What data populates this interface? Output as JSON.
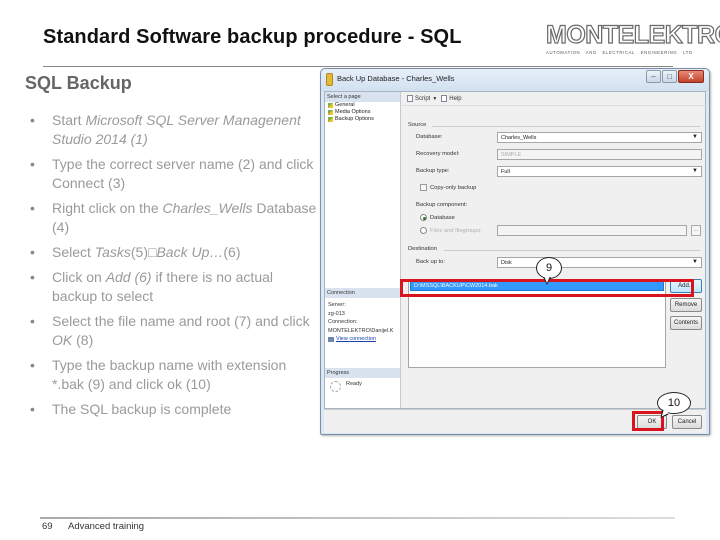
{
  "slide": {
    "title": "Standard Software backup procedure - SQL",
    "logo": {
      "name": "MONTELEKTRO",
      "tagline": "AUTOMATION AND ELECTRICAL ENGINEERING LTD"
    },
    "section_heading": "SQL Backup",
    "bullet_glyph": "•",
    "bullets": [
      {
        "parts": [
          {
            "text": "Start ",
            "italic": false
          },
          {
            "text": "Microsoft SQL Server Managenent Studio 2014 (1)",
            "italic": true
          }
        ]
      },
      {
        "parts": [
          {
            "text": "Type the correct server name (2) and click Connect (3)",
            "italic": false
          }
        ]
      },
      {
        "parts": [
          {
            "text": "Right click on the ",
            "italic": false
          },
          {
            "text": "Charles_Wells",
            "italic": true
          },
          {
            "text": " Database (4)",
            "italic": false
          }
        ]
      },
      {
        "parts": [
          {
            "text": "Select ",
            "italic": false
          },
          {
            "text": "Tasks",
            "italic": true
          },
          {
            "text": "(5)□",
            "italic": false
          },
          {
            "text": "Back Up…",
            "italic": true
          },
          {
            "text": "(6)",
            "italic": false
          }
        ]
      },
      {
        "parts": [
          {
            "text": "Click on ",
            "italic": false
          },
          {
            "text": "Add (6)",
            "italic": true
          },
          {
            "text": " if there is no actual backup to select",
            "italic": false
          }
        ]
      },
      {
        "parts": [
          {
            "text": "Select the file name and root (7) and click  ",
            "italic": false
          },
          {
            "text": "OK",
            "italic": true
          },
          {
            "text": " (8)",
            "italic": false
          }
        ]
      },
      {
        "parts": [
          {
            "text": "Type the backup name with extension *.bak (9) and click ok (10)",
            "italic": false
          }
        ]
      },
      {
        "parts": [
          {
            "text": "The SQL backup is complete",
            "italic": false
          }
        ]
      }
    ],
    "footer": {
      "page_number": "69",
      "text": "Advanced training"
    }
  },
  "dialog": {
    "title": "Back Up Database - Charles_Wells",
    "window_buttons": {
      "minimize": "–",
      "maximize": "□",
      "close": "X"
    },
    "sidebar": {
      "select_page_header": "Select a page",
      "pages": [
        "General",
        "Media Options",
        "Backup Options"
      ],
      "connection_header": "Connection",
      "server_label": "Server:",
      "server_value": "zg-013",
      "connection_label": "Connection:",
      "connection_value": "MONTELEKTRO\\Danijel.K",
      "view_connection_link": "View connection",
      "progress_header": "Progress",
      "progress_status": "Ready"
    },
    "toolbar": {
      "script_label": "Script",
      "script_dropdown": "▼",
      "help_label": "Help"
    },
    "source": {
      "group_label": "Source",
      "database_label": "Database:",
      "database_value": "Charles_Wells",
      "recovery_model_label": "Recovery model:",
      "recovery_model_value": "SIMPLE",
      "backup_type_label": "Backup type:",
      "backup_type_value": "Full",
      "copy_only_label": "Copy-only backup",
      "copy_only_checked": false,
      "backup_component_label": "Backup component:",
      "component_options": [
        "Database",
        "Files and filegroups:"
      ],
      "component_selected": "Database",
      "files_browse_label": "..."
    },
    "destination": {
      "group_label": "Destination",
      "back_up_to_label": "Back up to:",
      "back_up_to_value": "Disk",
      "paths": [
        "D:\\MSSQL\\BACKUP\\CW2014.bak"
      ],
      "selected_path": "D:\\MSSQL\\BACKUP\\CW2014.bak",
      "add_button": "Add...",
      "remove_button": "Remove",
      "contents_button": "Contents"
    },
    "footer_buttons": {
      "ok": "OK",
      "cancel": "Cancel"
    },
    "dropdown_arrow": "▼"
  },
  "annotations": {
    "callout_9": "9",
    "callout_10": "10",
    "highlight_color": "#d9141c"
  }
}
